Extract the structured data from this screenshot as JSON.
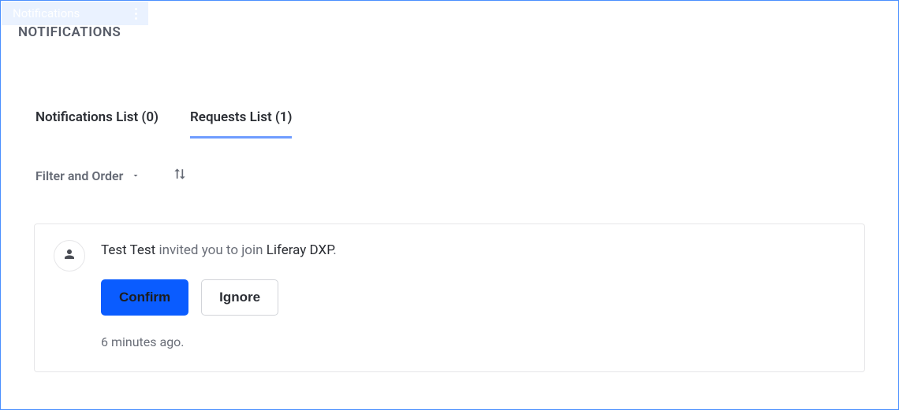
{
  "ghost_header": {
    "label": "Notifications"
  },
  "page": {
    "title": "NOTIFICATIONS"
  },
  "tabs": [
    {
      "label": "Notifications List (0)",
      "active": false
    },
    {
      "label": "Requests List (1)",
      "active": true
    }
  ],
  "toolbar": {
    "filter_label": "Filter and Order"
  },
  "request": {
    "user": "Test Test",
    "middle_text": " invited you to join ",
    "target": "Liferay DXP",
    "suffix": ".",
    "confirm_label": "Confirm",
    "ignore_label": "Ignore",
    "timestamp": "6 minutes ago."
  }
}
